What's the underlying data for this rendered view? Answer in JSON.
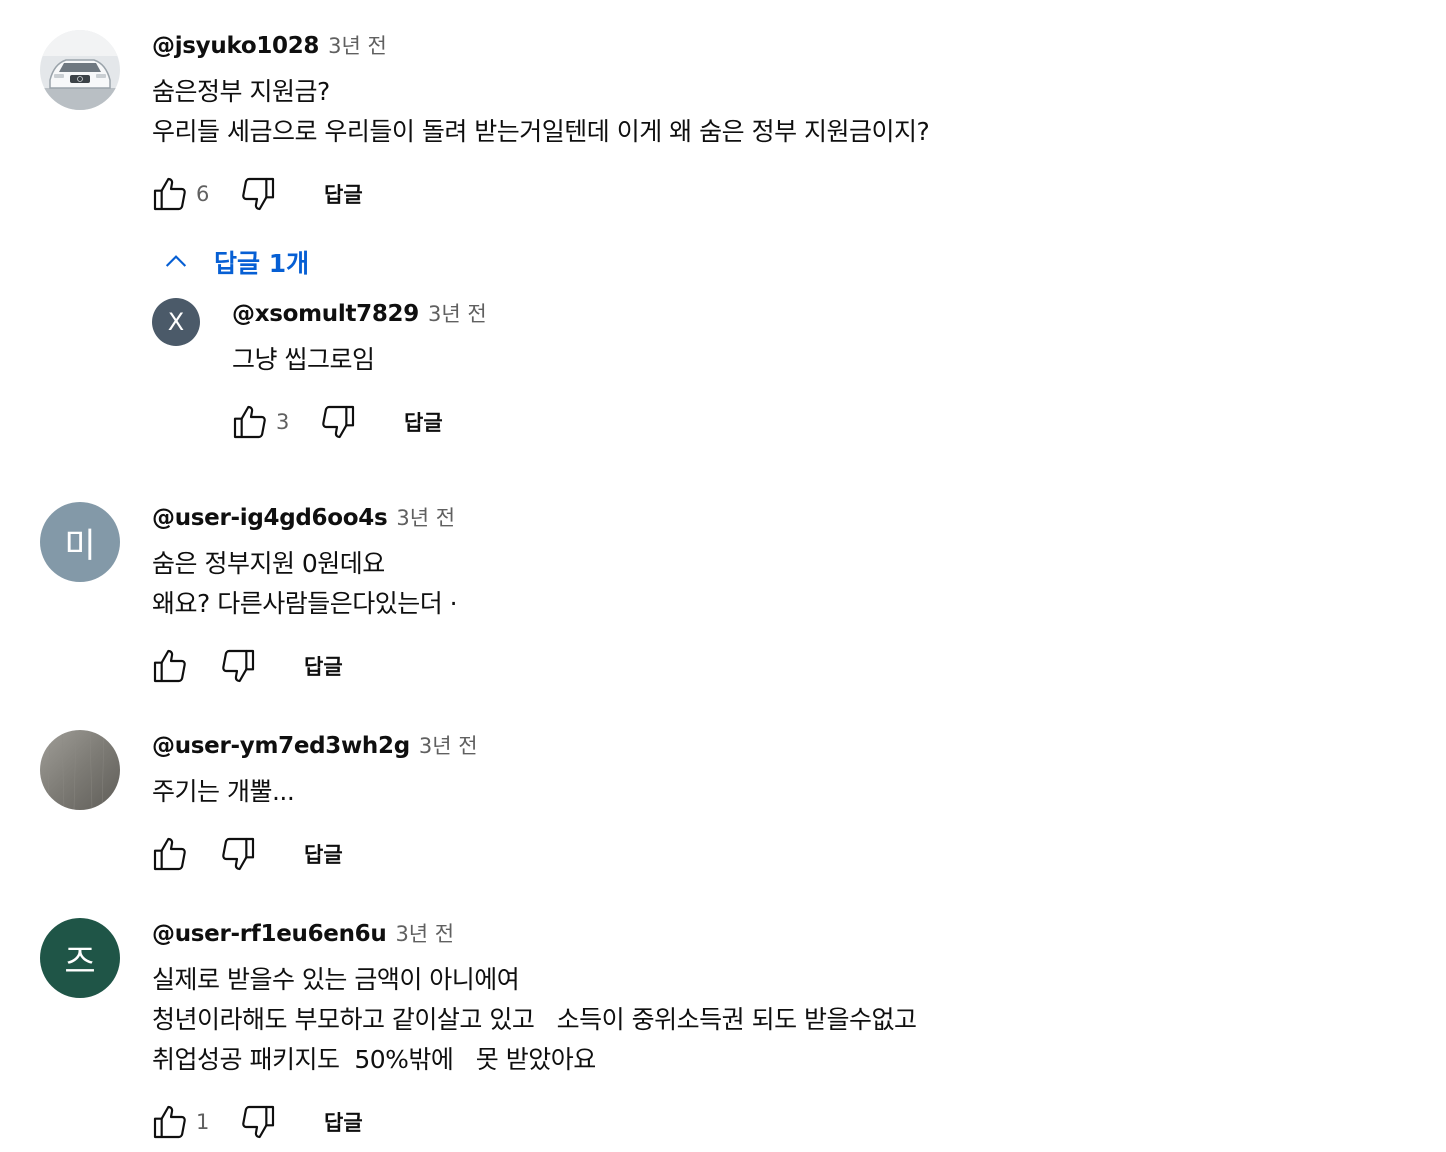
{
  "comments": [
    {
      "author": "@jsyuko1028",
      "time": "3년 전",
      "avatar": {
        "type": "image",
        "icon": "car-photo-avatar",
        "colors": [
          "#dfe3e6",
          "#9aa3aa",
          "#f5f6f7"
        ]
      },
      "lines": [
        "숨은정부 지원금?",
        "우리들 세금으로 우리들이 돌려 받는거일텐데 이게 왜 숨은 정부 지원금이지?"
      ],
      "likes": "6",
      "reply_label": "답글"
    },
    {
      "author": "@user-ig4gd6oo4s",
      "time": "3년 전",
      "avatar": {
        "type": "letter",
        "letter": "미",
        "color": "#8399a8"
      },
      "lines": [
        "숨은 정부지원 0원데요",
        "왜요? 다른사람들은다있는더 ·"
      ],
      "likes": "",
      "reply_label": "답글"
    },
    {
      "author": "@user-ym7ed3wh2g",
      "time": "3년 전",
      "avatar": {
        "type": "image",
        "icon": "gray-texture-avatar",
        "colors": [
          "#7d7b75",
          "#a09e98",
          "#5f5d58"
        ]
      },
      "lines": [
        "주기는 개뿔..."
      ],
      "likes": "",
      "reply_label": "답글"
    },
    {
      "author": "@user-rf1eu6en6u",
      "time": "3년 전",
      "avatar": {
        "type": "letter",
        "letter": "즈",
        "color": "#1f5547"
      },
      "lines": [
        "실제로 받을수 있는 금액이 아니에여",
        "청년이라해도 부모하고 같이살고 있고   소득이 중위소득권 되도 받을수없고",
        "취업성공 패키지도  50%밖에   못 받았아요"
      ],
      "likes": "1",
      "reply_label": "답글"
    }
  ],
  "replies_toggle": {
    "label": "답글 1개",
    "color": "#065fd4"
  },
  "reply": {
    "author": "@xsomult7829",
    "time": "3년 전",
    "avatar": {
      "type": "letter",
      "letter": "X",
      "color": "#4b5a69"
    },
    "lines": [
      "그냥 씹그로임"
    ],
    "likes": "3",
    "reply_label": "답글"
  }
}
